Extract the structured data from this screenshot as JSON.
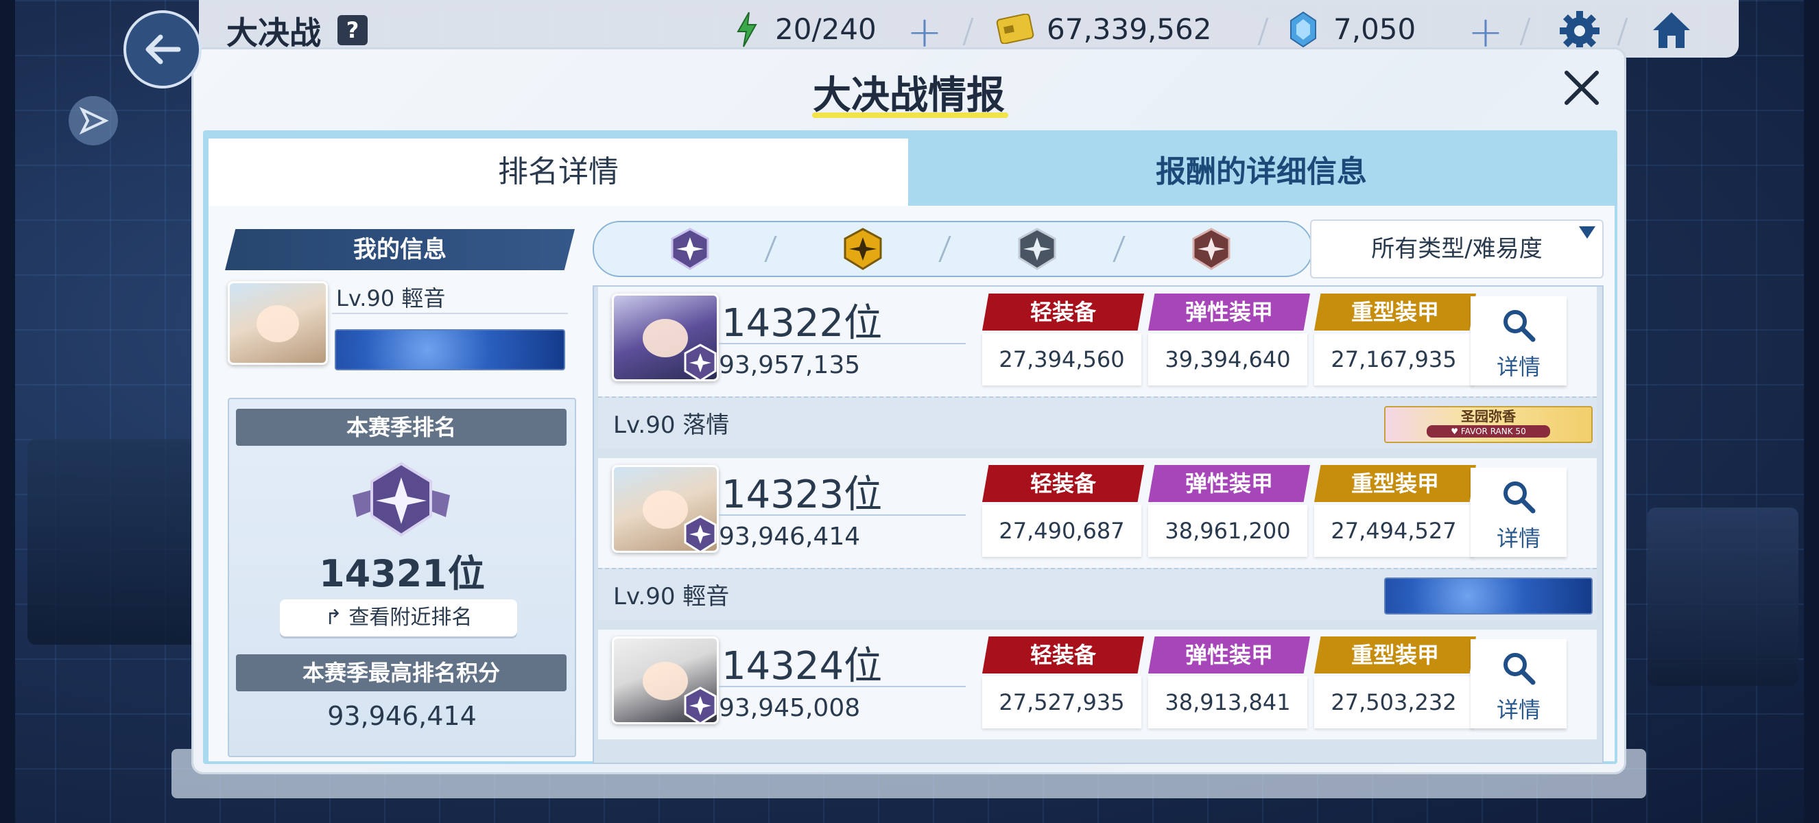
{
  "topbar": {
    "title": "大决战",
    "help_icon": "?",
    "ap": "20/240",
    "credits": "67,339,562",
    "gems": "7,050"
  },
  "modal": {
    "title": "大决战情报",
    "tabs": [
      "排名详情",
      "报酬的详细信息"
    ],
    "filter_dropdown": "所有类型/难易度"
  },
  "my_info": {
    "header": "我的信息",
    "name": "Lv.90 輕音",
    "season_rank_label": "本赛季排名",
    "season_rank": "14321位",
    "nearby_button": "查看附近排名",
    "best_score_label": "本赛季最高排名积分",
    "best_score": "93,946,414"
  },
  "armor_labels": {
    "light": "轻装备",
    "elastic": "弹性装甲",
    "heavy": "重型装甲"
  },
  "detail_label": "详情",
  "rankings": [
    {
      "rank": "14322位",
      "score": "93,957,135",
      "light": "27,394,560",
      "elastic": "39,394,640",
      "heavy": "27,167,935",
      "name": "Lv.90  落情",
      "banner_title": "圣园弥香",
      "banner_sub": "♥ FAVOR RANK 50"
    },
    {
      "rank": "14323位",
      "score": "93,946,414",
      "light": "27,490,687",
      "elastic": "38,961,200",
      "heavy": "27,494,527",
      "name": "Lv.90  輕音"
    },
    {
      "rank": "14324位",
      "score": "93,945,008",
      "light": "27,527,935",
      "elastic": "38,913,841",
      "heavy": "27,503,232"
    }
  ],
  "colors": {
    "light_armor": "#a8111c",
    "elastic_armor": "#a646b9",
    "heavy_armor": "#c78e0e",
    "title_underline": "#f2e34a"
  },
  "icons": [
    "back-arrow-icon",
    "share-icon",
    "energy-bolt-icon",
    "credit-card-icon",
    "gem-icon",
    "gear-icon",
    "home-icon",
    "close-icon",
    "search-icon",
    "rank-badge-icon"
  ]
}
